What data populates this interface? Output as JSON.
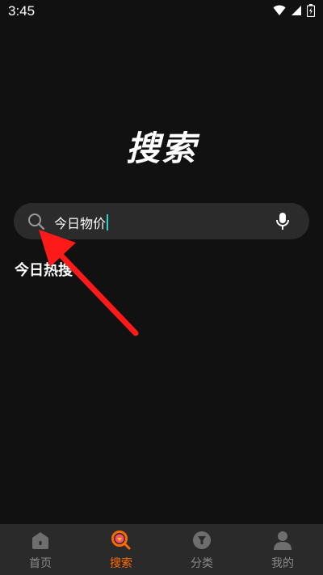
{
  "status_bar": {
    "time": "3:45",
    "icons": [
      "wifi-icon",
      "signal-icon",
      "battery-icon"
    ]
  },
  "title": "搜索",
  "search": {
    "value": "今日物价",
    "icon": "search-icon",
    "voice_icon": "microphone-icon"
  },
  "hot_label": "今日热搜",
  "nav": {
    "items": [
      {
        "label": "首页",
        "icon": "home-icon",
        "active": false
      },
      {
        "label": "搜索",
        "icon": "search-nav-icon",
        "active": true
      },
      {
        "label": "分类",
        "icon": "category-icon",
        "active": false
      },
      {
        "label": "我的",
        "icon": "profile-icon",
        "active": false
      }
    ]
  },
  "colors": {
    "background": "#111111",
    "search_bar": "#2b2b2b",
    "nav_bar": "#2a2a2a",
    "accent": "#ff6a00",
    "caret": "#2ad3c8",
    "annotation_arrow": "#ff1a1a"
  }
}
